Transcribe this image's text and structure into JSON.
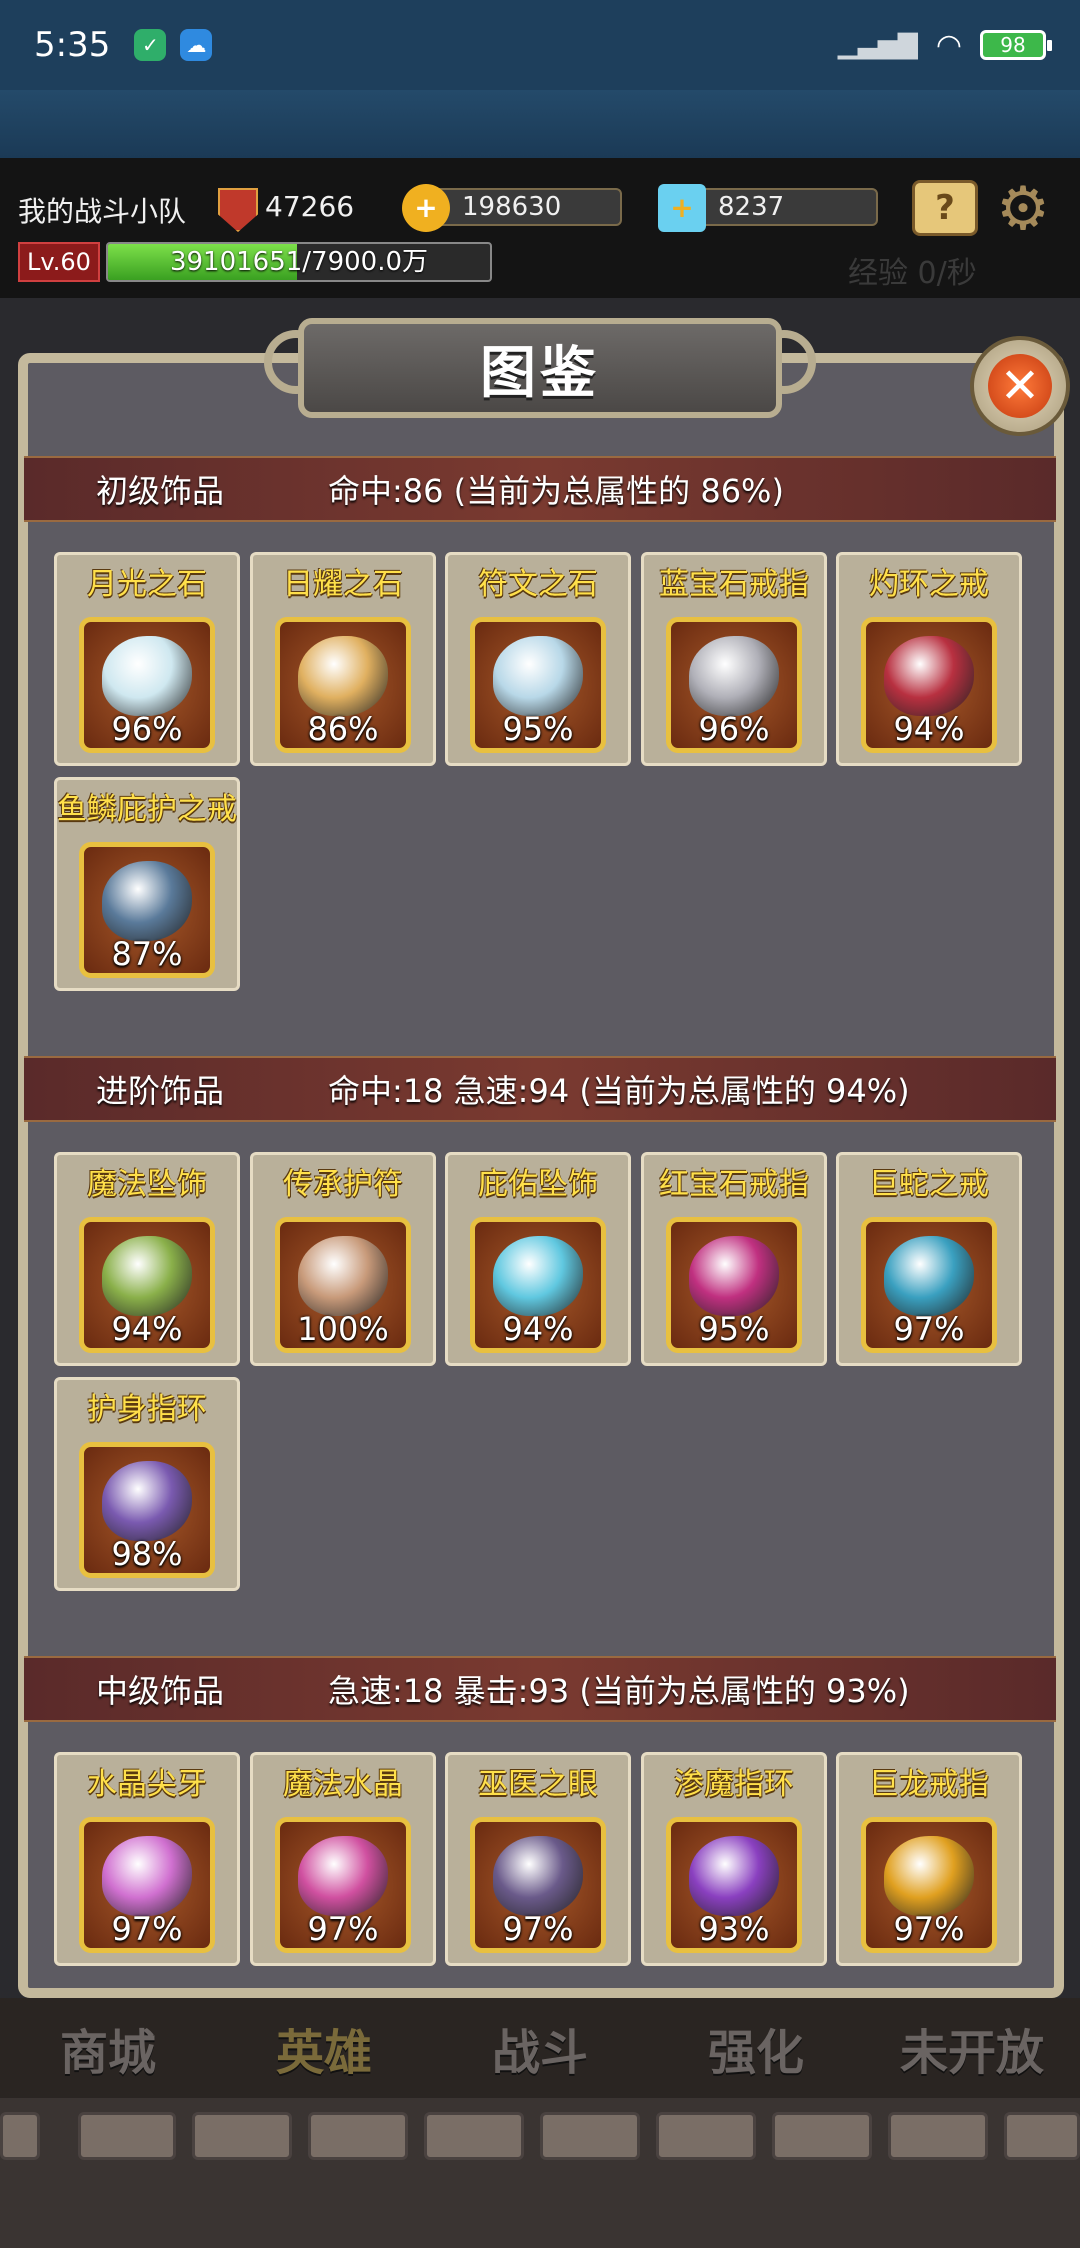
{
  "statusbar": {
    "time": "5:35",
    "battery": "98"
  },
  "hud": {
    "team_name": "我的战斗小队",
    "power": "47266",
    "gold": "198630",
    "gems": "8237",
    "level": "Lv.60",
    "exp_text_current": "39101651",
    "exp_text_max": "/7900.0万",
    "exp_fraction": 0.495,
    "exp_rate": "经验 0/秒"
  },
  "panel": {
    "title": "图鉴",
    "close_icon": "close-icon"
  },
  "sections": [
    {
      "name": "初级饰品",
      "bonus": "命中:86 (当前为总属性的 86%)",
      "items": [
        {
          "name": "月光之石",
          "pct": "96%",
          "color": "#cfe8f0"
        },
        {
          "name": "日耀之石",
          "pct": "86%",
          "color": "#e0b060"
        },
        {
          "name": "符文之石",
          "pct": "95%",
          "color": "#b8d8e8"
        },
        {
          "name": "蓝宝石戒指",
          "pct": "96%",
          "color": "#b0b0b8"
        },
        {
          "name": "灼环之戒",
          "pct": "94%",
          "color": "#b83040"
        },
        {
          "name": "鱼鳞庇护之戒",
          "pct": "87%",
          "color": "#5a7a9a"
        }
      ]
    },
    {
      "name": "进阶饰品",
      "bonus": "命中:18  急速:94 (当前为总属性的 94%)",
      "items": [
        {
          "name": "魔法坠饰",
          "pct": "94%",
          "color": "#8ab04a"
        },
        {
          "name": "传承护符",
          "pct": "100%",
          "color": "#c89a7a"
        },
        {
          "name": "庇佑坠饰",
          "pct": "94%",
          "color": "#60c8e0"
        },
        {
          "name": "红宝石戒指",
          "pct": "95%",
          "color": "#c03080"
        },
        {
          "name": "巨蛇之戒",
          "pct": "97%",
          "color": "#3aa0c0"
        },
        {
          "name": "护身指环",
          "pct": "98%",
          "color": "#7a5ab0"
        }
      ]
    },
    {
      "name": "中级饰品",
      "bonus": "急速:18  暴击:93 (当前为总属性的 93%)",
      "items": [
        {
          "name": "水晶尖牙",
          "pct": "97%",
          "color": "#d070d0"
        },
        {
          "name": "魔法水晶",
          "pct": "97%",
          "color": "#d050a0"
        },
        {
          "name": "巫医之眼",
          "pct": "97%",
          "color": "#6a5a8a"
        },
        {
          "name": "渗魔指环",
          "pct": "93%",
          "color": "#8a40c0"
        },
        {
          "name": "巨龙戒指",
          "pct": "97%",
          "color": "#e0a020"
        }
      ]
    }
  ],
  "bottom_nav": [
    {
      "label": "商城",
      "active": false
    },
    {
      "label": "英雄",
      "active": true
    },
    {
      "label": "战斗",
      "active": false
    },
    {
      "label": "强化",
      "active": false
    },
    {
      "label": "未开放",
      "active": false
    }
  ]
}
